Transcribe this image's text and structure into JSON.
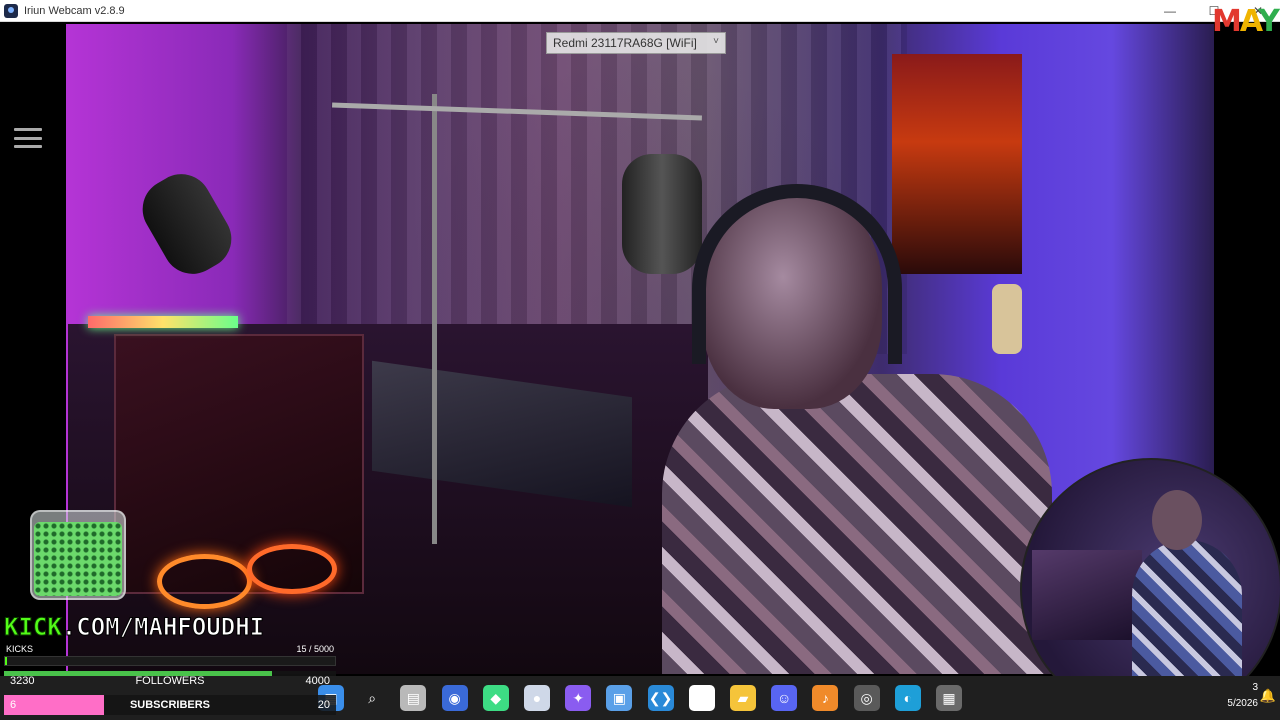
{
  "window": {
    "title": "Iriun Webcam v2.8.9",
    "controls": {
      "minimize": "—",
      "maximize": "☐",
      "close": "✕"
    }
  },
  "device_select": {
    "selected": "Redmi 23117RA68G [WiFi]"
  },
  "corner_logo": {
    "text_m": "M",
    "text_a": "A",
    "text_y": "Y"
  },
  "overlay": {
    "url_kick": "KICK",
    "url_rest": ".COM/MAHFOUDHI",
    "kicks": {
      "label": "KICKS",
      "count_text": "15  / 5000",
      "fraction": 0.003
    },
    "followers": {
      "current": "3230",
      "label": "FOLLOWERS",
      "goal": "4000",
      "fraction": 0.8075,
      "color": "#49c24a"
    },
    "subscribers": {
      "current": "6",
      "label": "SUBSCRIBERS",
      "goal": "20",
      "fraction": 0.3,
      "color": "#ff6ec7"
    }
  },
  "taskbar": {
    "icons": [
      {
        "name": "start-icon",
        "glyph": "▦",
        "color": "#3a8eea"
      },
      {
        "name": "search-icon",
        "glyph": "⌕",
        "color": "transparent"
      },
      {
        "name": "file-explorer-icon",
        "glyph": "▤",
        "color": "#b9b9b9"
      },
      {
        "name": "network-app-icon",
        "glyph": "◉",
        "color": "#3a6ad8"
      },
      {
        "name": "android-icon",
        "glyph": "◆",
        "color": "#3ddc84"
      },
      {
        "name": "webcam-app-icon",
        "glyph": "●",
        "color": "#cfd8e8"
      },
      {
        "name": "copilot-icon",
        "glyph": "✦",
        "color": "#8a5cf0"
      },
      {
        "name": "store-icon",
        "glyph": "▣",
        "color": "#5aa0e8"
      },
      {
        "name": "vscode-icon",
        "glyph": "❮❯",
        "color": "#2a8ad8"
      },
      {
        "name": "capcut-icon",
        "glyph": "✕",
        "color": "#ffffff"
      },
      {
        "name": "folder-icon",
        "glyph": "▰",
        "color": "#f5c43a"
      },
      {
        "name": "discord-icon",
        "glyph": "☺",
        "color": "#5865f2"
      },
      {
        "name": "fl-studio-icon",
        "glyph": "♪",
        "color": "#f08a2a"
      },
      {
        "name": "obs-icon",
        "glyph": "◎",
        "color": "#5a5a5a"
      },
      {
        "name": "edge-icon",
        "glyph": "◐",
        "color": "#1e9fd8"
      },
      {
        "name": "calculator-icon",
        "glyph": "▦",
        "color": "#6a6a6a"
      }
    ],
    "date_top": "3",
    "date_bottom": "5/2026",
    "notification_glyph": "🔔"
  }
}
